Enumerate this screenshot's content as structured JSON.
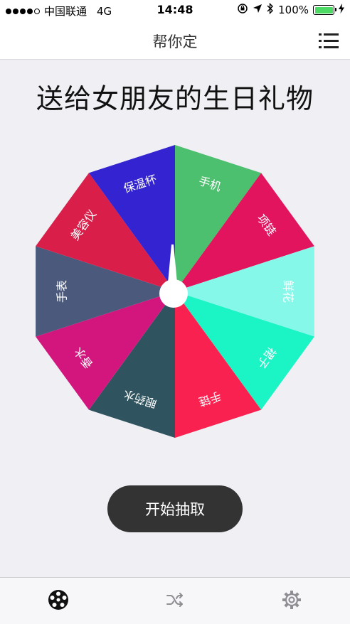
{
  "status_bar": {
    "carrier": "中国联通",
    "network": "4G",
    "time": "14:48",
    "battery_percent": "100%",
    "battery_level": 1.0,
    "signal_bars_filled": 4,
    "signal_bars_total": 5
  },
  "nav": {
    "title": "帮你定",
    "menu_icon": "list-icon"
  },
  "wheel": {
    "title": "送给女朋友的生日礼物",
    "segments": [
      {
        "label": "手机",
        "color": "#4dc06f"
      },
      {
        "label": "项链",
        "color": "#e3145e"
      },
      {
        "label": "鲜花",
        "color": "#86f8e9"
      },
      {
        "label": "裙子",
        "color": "#1bf4c5"
      },
      {
        "label": "手链",
        "color": "#f8214f"
      },
      {
        "label": "眼药水",
        "color": "#2f545f"
      },
      {
        "label": "香水",
        "color": "#d3167d"
      },
      {
        "label": "手表",
        "color": "#4b5a7c"
      },
      {
        "label": "美容仪",
        "color": "#d91e4a"
      },
      {
        "label": "保温杯",
        "color": "#3323d0"
      }
    ],
    "pointer_icon": "needle-pointer-icon"
  },
  "actions": {
    "start_label": "开始抽取"
  },
  "tab_bar": {
    "tabs": [
      {
        "icon": "wheel-icon",
        "active": true
      },
      {
        "icon": "shuffle-icon",
        "active": false
      },
      {
        "icon": "gear-icon",
        "active": false
      }
    ],
    "active_color": "#111111",
    "inactive_color": "#8e8e93"
  }
}
